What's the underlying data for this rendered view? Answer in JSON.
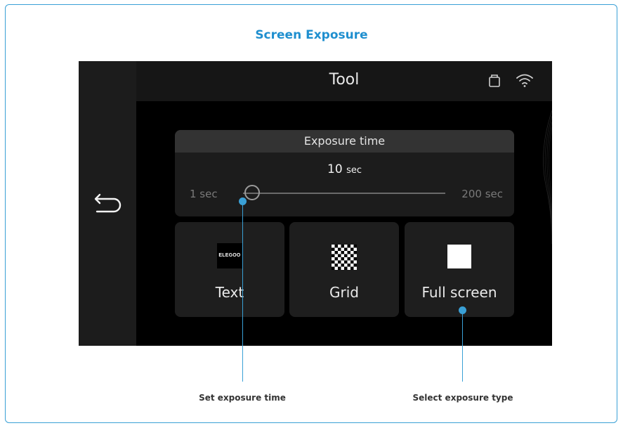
{
  "heading": "Screen Exposure",
  "topbar": {
    "title": "Tool",
    "storage_icon": "usb-storage-icon",
    "wifi_icon": "wifi-icon"
  },
  "back_icon": "back-arrow-icon",
  "exposure": {
    "header": "Exposure time",
    "value": "10",
    "value_unit": "sec",
    "min_label": "1 sec",
    "max_label": "200 sec",
    "slider_fraction": 0.045
  },
  "tiles": [
    {
      "label": "Text",
      "icon": "elegoo-logo-icon",
      "logo_text": "ELEGOO"
    },
    {
      "label": "Grid",
      "icon": "checkerboard-icon"
    },
    {
      "label": "Full screen",
      "icon": "white-square-icon"
    }
  ],
  "callouts": {
    "left": "Set exposure time",
    "right": "Select exposure type"
  },
  "colors": {
    "accent": "#3aa0d6",
    "heading": "#1f8fcf",
    "screen_bg": "#000000"
  }
}
